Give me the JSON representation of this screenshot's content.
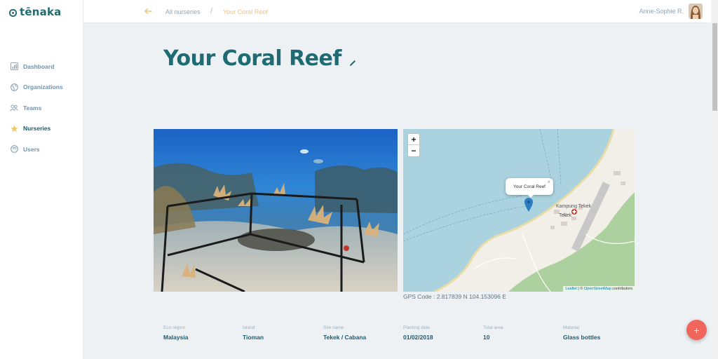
{
  "app": {
    "logo_text": "tēnaka"
  },
  "sidebar": {
    "items": [
      {
        "label": "Dashboard",
        "icon": "bar-chart-icon"
      },
      {
        "label": "Organizations",
        "icon": "globe-icon"
      },
      {
        "label": "Teams",
        "icon": "people-icon"
      },
      {
        "label": "Nurseries",
        "icon": "star-icon",
        "active": true
      },
      {
        "label": "Users",
        "icon": "user-face-icon"
      }
    ]
  },
  "topbar": {
    "breadcrumb_parent": "All nurseries",
    "breadcrumb_separator": "/",
    "breadcrumb_current": "Your Coral Reef",
    "user_name": "Anne-Sophie R."
  },
  "page": {
    "title": "Your Coral Reef"
  },
  "map": {
    "zoom_in": "+",
    "zoom_out": "−",
    "popup_text": "Your Coral Reef",
    "popup_close": "×",
    "place_label_1": "Kampung Tekek",
    "place_label_2": "Tekek",
    "attribution_leaflet": "Leaflet",
    "attribution_sep": " | © ",
    "attribution_osm": "OpenStreetMap",
    "attribution_contrib": " contributors"
  },
  "gps": {
    "text": "GPS Code : 2.817839 N 104.153096 E"
  },
  "facts": [
    {
      "label": "Eco région",
      "value": "Malaysia"
    },
    {
      "label": "Island",
      "value": "Tioman"
    },
    {
      "label": "Site name",
      "value": "Tekek / Cabana"
    },
    {
      "label": "Planting date",
      "value": "01/02/2018"
    },
    {
      "label": "Total area",
      "value": "10"
    },
    {
      "label": "Material",
      "value": "Glass bottles"
    }
  ],
  "fab": {
    "label": "+"
  },
  "colors": {
    "brand": "#1f6b73",
    "accent": "#f0c47d",
    "fab": "#f0665c",
    "sea": "#aad3df"
  }
}
